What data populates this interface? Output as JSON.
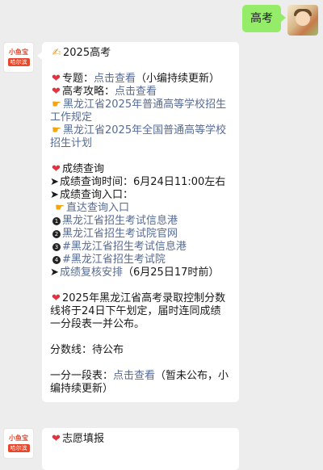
{
  "user_message": {
    "text": "高考"
  },
  "bot": {
    "avatar_name": "小鱼宝",
    "avatar_city": "哈尔滨",
    "title": "2025高考",
    "special_label": "专题：",
    "special_link": "点击查看",
    "special_note": "（小编持续更新）",
    "guide_label": "高考攻略：",
    "guide_link": "点击查看",
    "rule_link": "黑龙江省2025年普通高等学校招生工作规定",
    "plan_link": "黑龙江省2025年全国普通高等学校招生计划",
    "score_title": "成绩查询",
    "score_time": "成绩查询时间：6月24日11:00左右",
    "score_entry": "成绩查询入口：",
    "direct_link": "直达查询入口",
    "entries": [
      {
        "num": "1",
        "text": "黑龙江省招生考试信息港"
      },
      {
        "num": "2",
        "text": "黑龙江省招生考试院官网"
      },
      {
        "num": "3",
        "text": "#黑龙江省招生考试信息港"
      },
      {
        "num": "4",
        "text": "#黑龙江省招生考试院"
      }
    ],
    "review_link": "成绩复核安排",
    "review_note": "（6月25日17时前）",
    "cutoff_text": "2025年黑龙江省高考录取控制分数线将于24日下午划定，届时连同成绩一分段表一并公布。",
    "score_line": "分数线：待公布",
    "segment_label": "一分一段表：",
    "segment_link": "点击查看",
    "segment_note": "（暂未公布，小编持续更新）",
    "next_title": "志愿填报"
  },
  "icons": {
    "heart": "heart-icon",
    "hand": "pointing-hand-icon",
    "pen": "writing-hand-icon",
    "arrow": "arrow-icon"
  },
  "colors": {
    "link": "#576b95",
    "user_bubble": "#95ec69",
    "background": "#ededed",
    "heart": "#e0323f"
  }
}
